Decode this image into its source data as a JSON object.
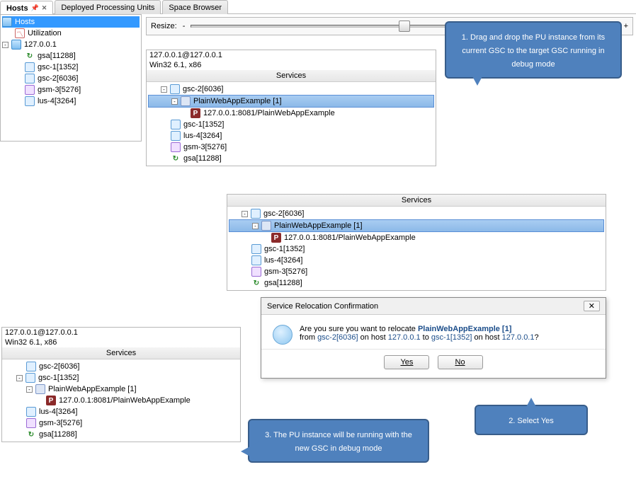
{
  "tabs": {
    "hosts": "Hosts",
    "dpu": "Deployed Processing Units",
    "sb": "Space Browser"
  },
  "leftTree": {
    "root": "Hosts",
    "util": "Utilization",
    "host": "127.0.0.1",
    "gsa": "gsa[11288]",
    "gsc1": "gsc-1[1352]",
    "gsc2": "gsc-2[6036]",
    "gsm": "gsm-3[5276]",
    "lus": "lus-4[3264]"
  },
  "resize": {
    "label": "Resize:",
    "minus": "-",
    "plus": "+"
  },
  "panel1": {
    "breadcrumb": "127.0.0.1@127.0.0.1",
    "os": "Win32 6.1, x86",
    "header": "Services",
    "gsc2": "gsc-2[6036]",
    "pu": "PlainWebAppExample [1]",
    "url": "127.0.0.1:8081/PlainWebAppExample",
    "gsc1": "gsc-1[1352]",
    "lus": "lus-4[3264]",
    "gsm": "gsm-3[5276]",
    "gsa": "gsa[11288]"
  },
  "panel2": {
    "header": "Services",
    "gsc2": "gsc-2[6036]",
    "pu": "PlainWebAppExample [1]",
    "url": "127.0.0.1:8081/PlainWebAppExample",
    "gsc1": "gsc-1[1352]",
    "lus": "lus-4[3264]",
    "gsm": "gsm-3[5276]",
    "gsa": "gsa[11288]"
  },
  "panel3": {
    "breadcrumb": "127.0.0.1@127.0.0.1",
    "os": "Win32 6.1, x86",
    "header": "Services",
    "gsc2": "gsc-2[6036]",
    "gsc1": "gsc-1[1352]",
    "pu": "PlainWebAppExample [1]",
    "url": "127.0.0.1:8081/PlainWebAppExample",
    "lus": "lus-4[3264]",
    "gsm": "gsm-3[5276]",
    "gsa": "gsa[11288]"
  },
  "dialog": {
    "title": "Service Relocation Confirmation",
    "line1_a": "Are you sure you want to relocate ",
    "line1_b": "PlainWebAppExample [1]",
    "line2_a": "from ",
    "line2_gsc2": "gsc-2[6036]",
    "line2_b": " on host ",
    "line2_host1": "127.0.0.1",
    "line2_c": " to ",
    "line2_gsc1": "gsc-1[1352]",
    "line2_d": " on host ",
    "line2_host2": "127.0.0.1",
    "line2_e": "?",
    "yes": "Yes",
    "no": "No"
  },
  "callouts": {
    "c1": "1. Drag and drop the PU instance from its current GSC to the target GSC running in debug mode",
    "c2": "2. Select Yes",
    "c3": "3. The PU instance will be running with the new GSC in debug mode"
  }
}
